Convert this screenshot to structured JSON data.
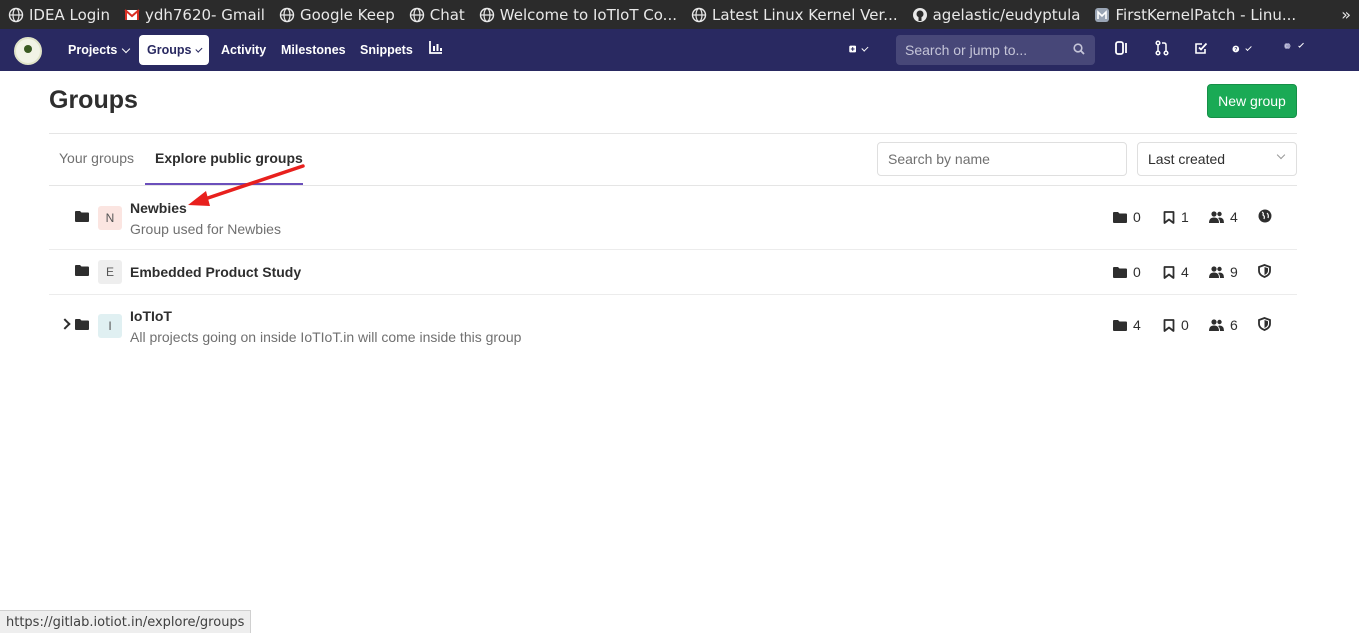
{
  "bookmarks": [
    {
      "label": "IDEA Login",
      "icon": "globe-icon"
    },
    {
      "label": "ydh7620- Gmail",
      "icon": "gmail-icon"
    },
    {
      "label": "Google Keep",
      "icon": "globe-icon"
    },
    {
      "label": "Chat",
      "icon": "globe-icon"
    },
    {
      "label": "Welcome to IoTIoT Co...",
      "icon": "globe-icon"
    },
    {
      "label": "Latest Linux Kernel Ver...",
      "icon": "globe-icon"
    },
    {
      "label": "agelastic/eudyptula",
      "icon": "github-icon"
    },
    {
      "label": "FirstKernelPatch - Linu...",
      "icon": "mediawiki-icon"
    }
  ],
  "bookmarks_more": "»",
  "nav": {
    "projects": "Projects",
    "groups": "Groups",
    "activity": "Activity",
    "milestones": "Milestones",
    "snippets": "Snippets",
    "search_placeholder": "Search or jump to..."
  },
  "page": {
    "title": "Groups",
    "new_group": "New group"
  },
  "tabs": {
    "your_groups": "Your groups",
    "explore": "Explore public groups"
  },
  "filter": {
    "placeholder": "Search by name",
    "sort": "Last created"
  },
  "groups": [
    {
      "initial": "N",
      "name": "Newbies",
      "description": "Group used for Newbies",
      "subgroups": "0",
      "projects": "1",
      "members": "4",
      "visibility": "public",
      "avatar_color": "#fbe5e1",
      "expandable": false
    },
    {
      "initial": "E",
      "name": "Embedded Product Study",
      "description": "",
      "subgroups": "0",
      "projects": "4",
      "members": "9",
      "visibility": "internal",
      "avatar_color": "#eeeeee",
      "expandable": false
    },
    {
      "initial": "I",
      "name": "IoTIoT",
      "description": "All projects going on inside IoTIoT.in will come inside this group",
      "subgroups": "4",
      "projects": "0",
      "members": "6",
      "visibility": "internal",
      "avatar_color": "#e0f0f2",
      "expandable": true
    }
  ],
  "status_url": "https://gitlab.iotiot.in/explore/groups",
  "colors": {
    "navbar": "#292961",
    "accent": "#6b4fbb",
    "new_group": "#1aaa55",
    "arrow": "#e8201d"
  }
}
